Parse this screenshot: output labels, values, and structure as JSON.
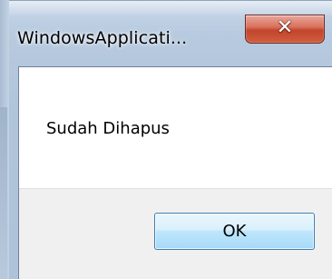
{
  "window": {
    "title": "WindowsApplicati...",
    "close_glyph": "✕",
    "close_icon": "close-icon"
  },
  "dialog": {
    "message": "Sudah Dihapus",
    "ok_label": "OK"
  },
  "colors": {
    "frame": "#b7cadf",
    "close_button": "#c2442c",
    "ok_button_border": "#3c7fb1",
    "button_bar": "#f0f0f0"
  }
}
